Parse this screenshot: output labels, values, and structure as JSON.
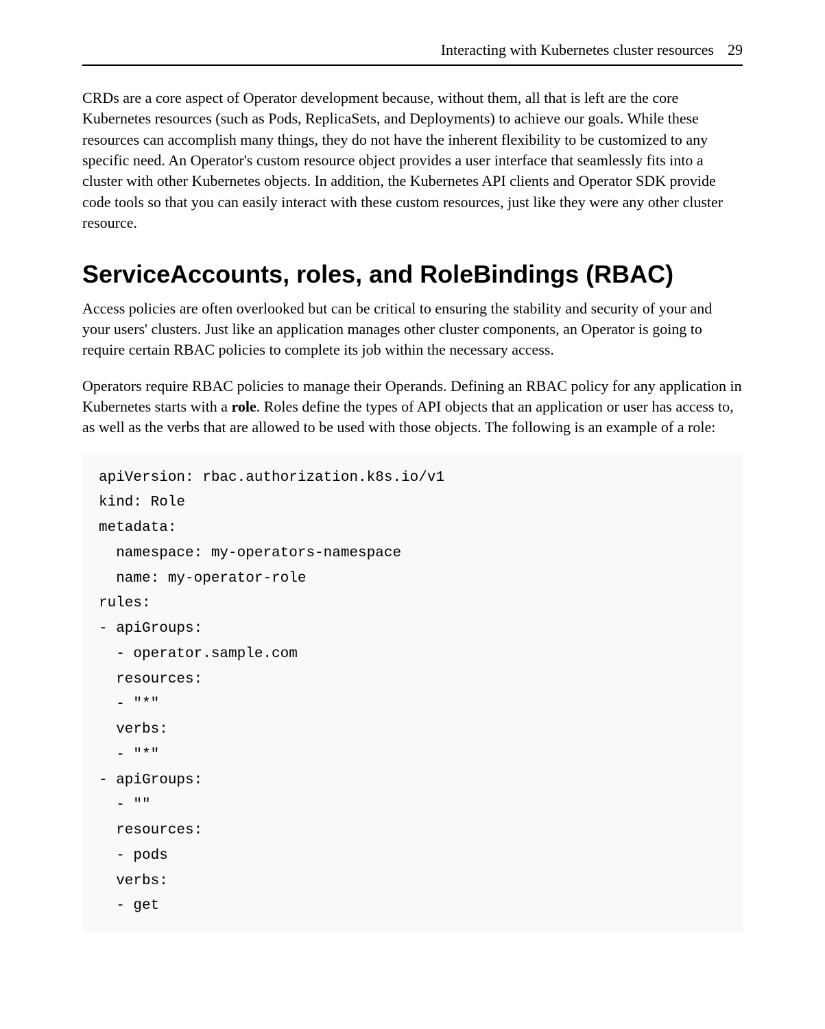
{
  "header": {
    "title": "Interacting with Kubernetes cluster resources",
    "page_number": "29"
  },
  "paragraphs": {
    "p1": "CRDs are a core aspect of Operator development because, without them, all that is left are the core Kubernetes resources (such as Pods, ReplicaSets, and Deployments) to achieve our goals. While these resources can accomplish many things, they do not have the inherent flexibility to be customized to any specific need. An Operator's custom resource object provides a user interface that seamlessly fits into a cluster with other Kubernetes objects. In addition, the Kubernetes API clients and Operator SDK provide code tools so that you can easily interact with these custom resources, just like they were any other cluster resource.",
    "heading": "ServiceAccounts, roles, and RoleBindings (RBAC)",
    "p2": "Access policies are often overlooked but can be critical to ensuring the stability and security of your and your users' clusters. Just like an application manages other cluster components, an Operator is going to require certain RBAC policies to complete its job within the necessary access.",
    "p3_part1": "Operators require RBAC policies to manage their Operands. Defining an RBAC policy for any application in Kubernetes starts with a ",
    "p3_bold": "role",
    "p3_part2": ". Roles define the types of API objects that an application or user has access to, as well as the verbs that are allowed to be used with those objects. The following is an example of a role:"
  },
  "code": {
    "line1": "apiVersion: rbac.authorization.k8s.io/v1",
    "line2": "kind: Role",
    "line3": "metadata:",
    "line4": "  namespace: my-operators-namespace",
    "line5": "  name: my-operator-role",
    "line6": "rules:",
    "line7": "- apiGroups:",
    "line8": "  - operator.sample.com",
    "line9": "  resources:",
    "line10": "  - \"*\"",
    "line11": "  verbs:",
    "line12": "  - \"*\"",
    "line13": "- apiGroups:",
    "line14": "  - \"\"",
    "line15": "  resources:",
    "line16": "  - pods",
    "line17": "  verbs:",
    "line18": "  - get"
  }
}
